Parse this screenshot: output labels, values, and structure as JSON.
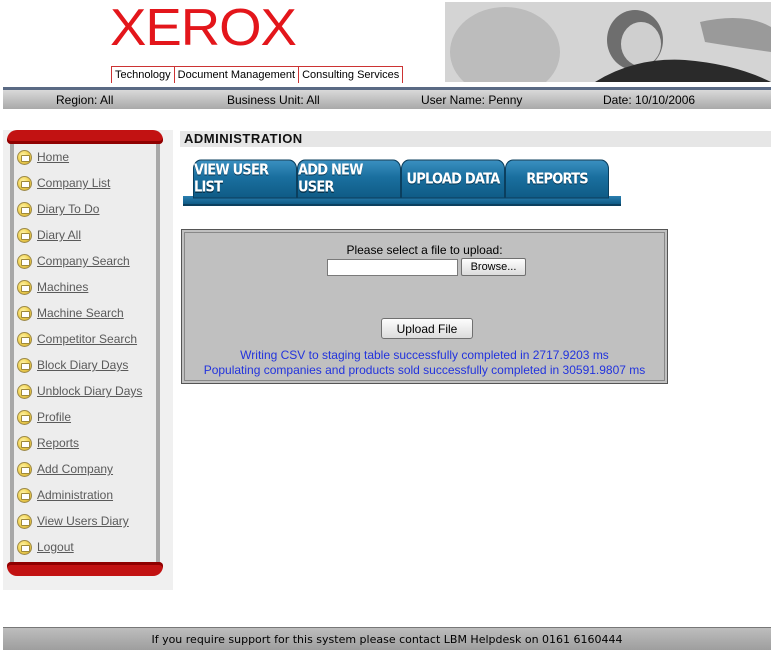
{
  "header": {
    "logo_text": "XEROX",
    "tagline": [
      "Technology",
      "Document Management",
      "Consulting Services"
    ]
  },
  "infobar": {
    "region": "Region: All",
    "business_unit": "Business Unit: All",
    "user_name": "User Name: Penny",
    "date": "Date: 10/10/2006"
  },
  "sidebar": {
    "items": [
      {
        "label": "Home",
        "icon": "folder-icon"
      },
      {
        "label": "Company List",
        "icon": "folder-icon"
      },
      {
        "label": "Diary To Do",
        "icon": "folder-icon"
      },
      {
        "label": "Diary All",
        "icon": "folder-icon"
      },
      {
        "label": "Company Search",
        "icon": "folder-icon"
      },
      {
        "label": "Machines",
        "icon": "folder-icon"
      },
      {
        "label": "Machine Search",
        "icon": "folder-icon"
      },
      {
        "label": "Competitor Search",
        "icon": "folder-icon"
      },
      {
        "label": "Block Diary Days",
        "icon": "folder-icon"
      },
      {
        "label": "Unblock Diary Days",
        "icon": "folder-icon"
      },
      {
        "label": "Profile",
        "icon": "folder-icon"
      },
      {
        "label": "Reports",
        "icon": "folder-icon"
      },
      {
        "label": "Add Company",
        "icon": "folder-icon"
      },
      {
        "label": "Administration",
        "icon": "folder-icon"
      },
      {
        "label": "View Users Diary",
        "icon": "folder-icon"
      },
      {
        "label": "Logout",
        "icon": "folder-icon"
      }
    ]
  },
  "main": {
    "section_title": "ADMINISTRATION",
    "tabs": [
      {
        "label": "VIEW USER LIST"
      },
      {
        "label": "ADD NEW USER"
      },
      {
        "label": "UPLOAD DATA"
      },
      {
        "label": "REPORTS"
      }
    ],
    "upload": {
      "prompt": "Please select a file to upload:",
      "file_value": "",
      "browse_label": "Browse...",
      "upload_label": "Upload File",
      "status_messages": [
        "Writing CSV to staging table successfully completed in 2717.9203 ms",
        "Populating companies and products sold successfully completed in 30591.9807 ms"
      ]
    }
  },
  "footer": {
    "text": "If you require support for this system please contact LBM Helpdesk on 0161 6160444"
  },
  "colors": {
    "brand_red": "#e3161b",
    "tab_blue": "#1a6f9f",
    "status_blue": "#2233dd"
  }
}
